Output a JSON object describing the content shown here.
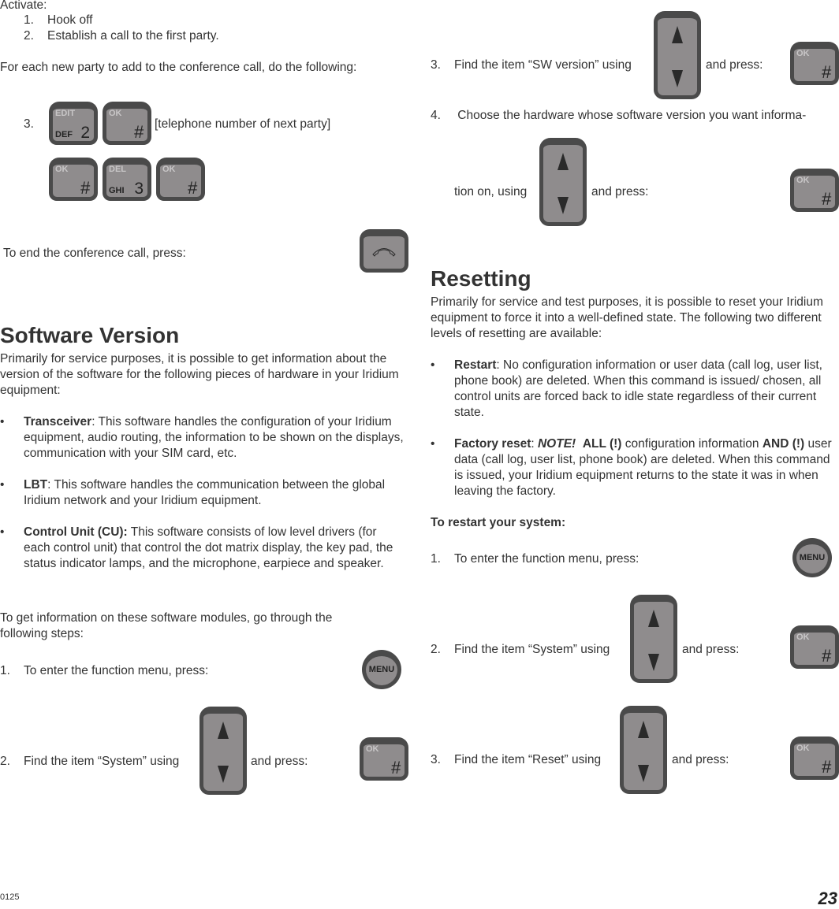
{
  "left": {
    "activate_label": "Activate:",
    "activate_steps": [
      {
        "num": "1.",
        "text": "Hook off"
      },
      {
        "num": "2.",
        "text": "Establish a call to the first party."
      }
    ],
    "for_each_text": "For each new party to add to the conference call, do the following:",
    "step3_num": "3.",
    "step3_text": "[telephone number of next party]",
    "keys_row1": [
      {
        "top": "EDIT",
        "bottom_left": "DEF",
        "main": "2"
      },
      {
        "top": "OK",
        "bottom_left": "",
        "main": "#"
      }
    ],
    "keys_row2": [
      {
        "top": "OK",
        "bottom_left": "",
        "main": "#"
      },
      {
        "top": "DEL",
        "bottom_left": "GHI",
        "main": "3"
      },
      {
        "top": "OK",
        "bottom_left": "",
        "main": "#"
      }
    ],
    "end_call_text": "To end the conference call, press:",
    "sw_heading": "Software Version",
    "sw_intro": "Primarily for service purposes, it is possible to get information about the version of the software for the following pieces of hardware in your Iridium equipment:",
    "sw_bullets": [
      {
        "term": "Transceiver",
        "sep": ": ",
        "text": "This software handles the configuration of your Iridium equipment, audio routing, the information to be shown on the displays, communication with your SIM card, etc."
      },
      {
        "term": "LBT",
        "sep": ": ",
        "text": "This software handles the communication between the global Iridium network and your Iridium equipment."
      },
      {
        "term": "Control Unit (CU):",
        "sep": " ",
        "text": "This software consists of low level drivers (for each control unit) that control the dot matrix display, the key pad, the status indicator lamps, and the microphone, earpiece and speaker."
      }
    ],
    "steps_intro": "To get information on these software modules, go through the following steps:",
    "sw_step1": {
      "num": "1.",
      "text": "To enter the function menu, press:"
    },
    "sw_step2": {
      "num": "2.",
      "text": "Find the item “System” using",
      "after": "and press:"
    }
  },
  "right": {
    "sw_step3": {
      "num": "3.",
      "text": "Find the item “SW version” using",
      "after": "and press:"
    },
    "sw_step4": {
      "num": "4.",
      "text": " Choose the hardware whose software version you want informa-",
      "cont": "tion on, using",
      "after": "and press:"
    },
    "reset_heading": "Resetting",
    "reset_intro": "Primarily for service and test purposes, it is possible to reset your Iridium equipment to force it into a well-defined state. The following two different levels of resetting are available:",
    "restart_term": "Restart",
    "restart_text": ": No configuration information or user data (call log, user list, phone book) are deleted. When this command is issued/ chosen, all control units are forced back to idle state regardless of their current state.",
    "factory_term": "Factory reset",
    "factory_sep": ":  ",
    "factory_note": "NOTE!",
    "factory_all": "ALL (!)",
    "factory_mid": " configuration information ",
    "factory_and": "AND (!)",
    "factory_rest": " user data (call log, user list, phone book) are deleted. When this command is issued, your Iridium equipment returns to the state it was in when leaving the factory.",
    "restart_heading": "To restart your system:",
    "rs_step1": {
      "num": "1.",
      "text": "To enter the function menu, press:"
    },
    "rs_step2": {
      "num": "2.",
      "text": "Find the item “System” using",
      "after": "and press:"
    },
    "rs_step3": {
      "num": "3.",
      "text": "Find the item “Reset” using",
      "after": "and press:"
    }
  },
  "keys": {
    "ok_top": "OK",
    "ok_main": "#",
    "menu_label": "MENU"
  },
  "footer": {
    "code": "0125",
    "page_number": "23"
  }
}
